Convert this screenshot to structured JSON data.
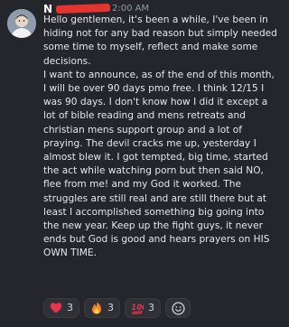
{
  "message": {
    "author": "N",
    "timestamp": "2:00 AM",
    "paragraphs": [
      "Hello gentlemen, it's been a while, I've been in hiding not for any bad reason but simply needed some time to myself, reflect and make some decisions.",
      "I want to announce, as of the end of this month, I will be over 90 days pmo free. I think 12/15 I was 90 days. I don't know how I did it except a lot of bible reading and mens retreats and christian mens support group and a lot of praying. The devil cracks me up, yesterday I almost blew it. I got tempted, big time, started the act while watching porn but then said NO, flee from me! and my God it worked. The struggles are still real and are still there but at least I accomplished something big going into the new year. Keep up the fight guys, it never ends but God is good and hears prayers on HIS OWN TIME."
    ]
  },
  "reactions": [
    {
      "icon": "heart-emoji-icon",
      "count": "3"
    },
    {
      "icon": "fire-emoji-icon",
      "count": "3"
    },
    {
      "icon": "hundred-points-emoji-icon",
      "count": "3"
    }
  ],
  "add_reaction_icon": "add-reaction-smiley-icon",
  "colors": {
    "background": "#24262b",
    "text": "#e6e7ea",
    "timestamp": "#949ba4",
    "heart": "#e8344e",
    "fire": "#f7842a",
    "hundred": "#e8344e"
  }
}
